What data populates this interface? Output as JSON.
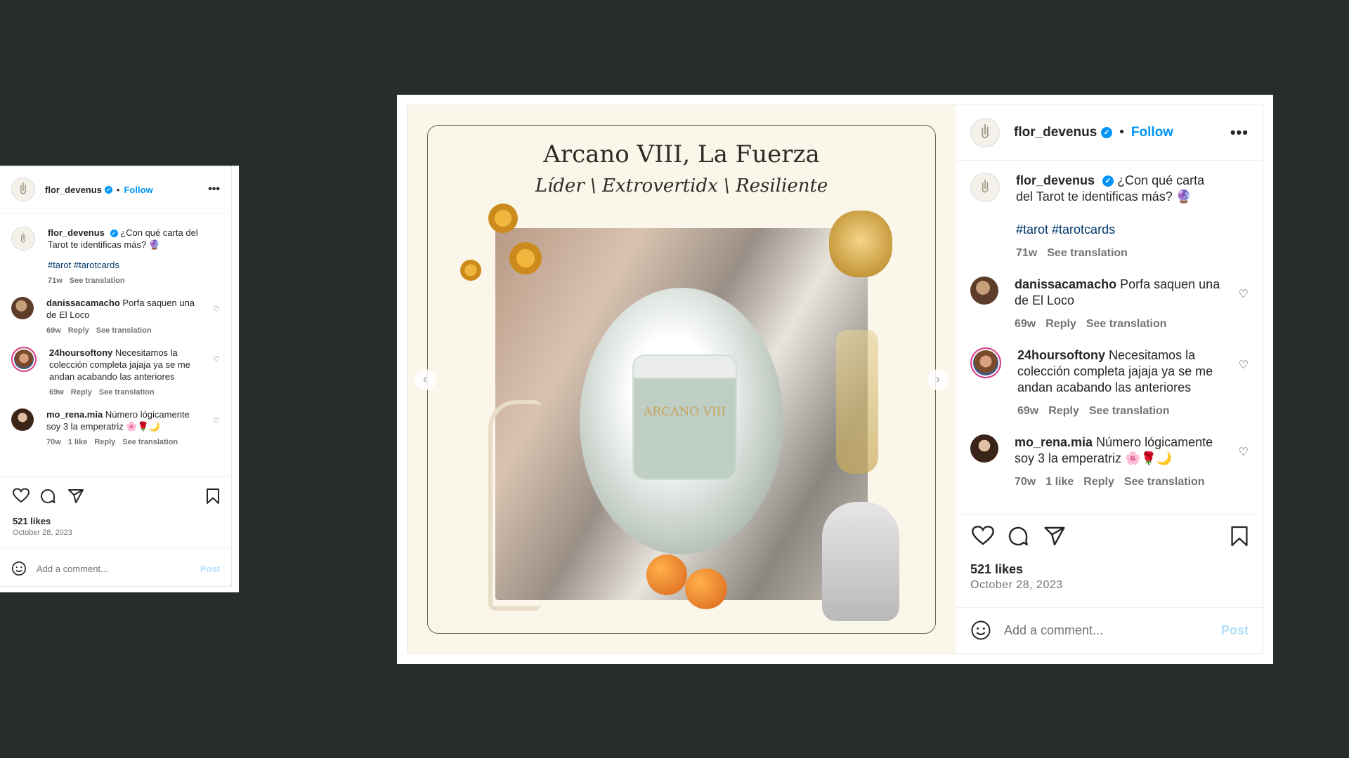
{
  "post": {
    "username": "flor_devenus",
    "follow_label": "Follow",
    "separator": "•",
    "more_label": "•••",
    "caption_text": "¿Con qué carta del Tarot te identificas más? 🔮",
    "hashtags": "#tarot #tarotcards",
    "caption_age": "71w",
    "see_translation": "See translation",
    "likes": "521 likes",
    "date": "October 28, 2023",
    "add_comment_placeholder": "Add a comment...",
    "post_label": "Post"
  },
  "image": {
    "title": "Arcano VIII, La Fuerza",
    "subtitle": "Líder \\ Extrovertidx \\ Resiliente",
    "jar_label": "ARCANO VIII"
  },
  "comments": [
    {
      "username": "danissacamacho",
      "text": "Porfa saquen una de El Loco",
      "age": "69w",
      "likes": "",
      "reply": "Reply",
      "translate": "See translation"
    },
    {
      "username": "24hoursoftony",
      "text": "Necesitamos la colección completa jajaja ya se me andan acabando las anteriores",
      "age": "69w",
      "likes": "",
      "reply": "Reply",
      "translate": "See translation"
    },
    {
      "username": "mo_rena.mia",
      "text": "Número lógicamente soy 3 la emperatriz 🌸🌹🌙",
      "age": "70w",
      "likes": "1 like",
      "reply": "Reply",
      "translate": "See translation"
    }
  ],
  "icons": {
    "heart": "heart-icon",
    "comment": "comment-icon",
    "share": "share-icon",
    "save": "bookmark-icon",
    "emoji": "emoji-icon",
    "verified": "verified-badge-icon",
    "prev": "chevron-left-icon",
    "next": "chevron-right-icon"
  },
  "colors": {
    "background": "#262d2b",
    "accent": "#0095f6",
    "hashtag": "#00376b",
    "post_disabled": "#b2dffc",
    "art_paper": "#fbf6ea"
  }
}
